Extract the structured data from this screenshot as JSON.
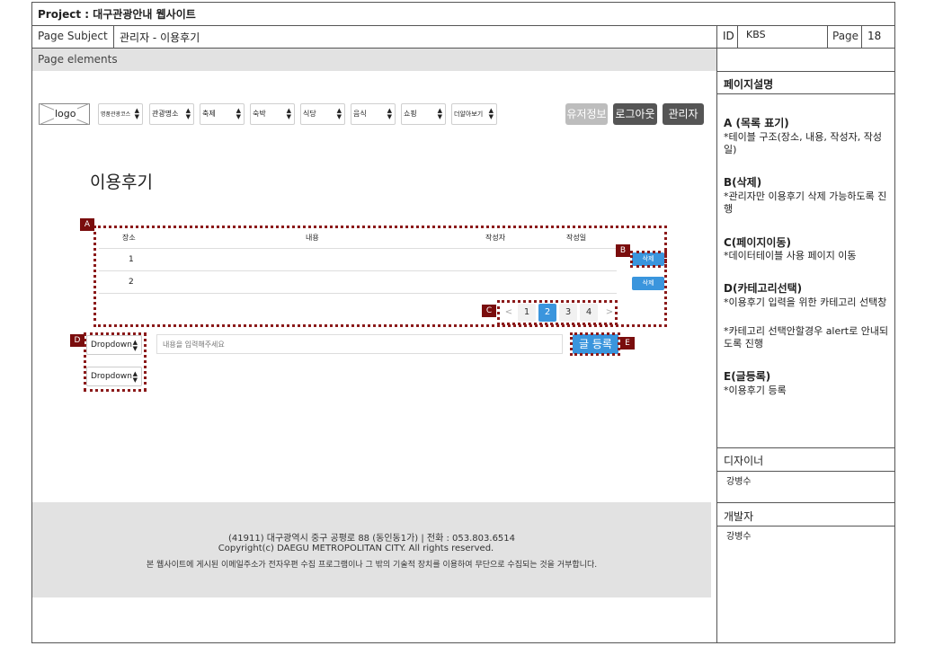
{
  "header": {
    "project": "Project : 대구관광안내 웹사이트",
    "subject_label": "Page Subject",
    "subject_value": "관리자 - 이용후기",
    "id_label": "ID",
    "id_value": "KBS",
    "page_label": "Page",
    "page_value": "18",
    "elements_label": "Page elements"
  },
  "nav": {
    "logo": "logo",
    "menus": [
      "명품관광코스",
      "관광명소",
      "축제",
      "숙박",
      "식당",
      "음식",
      "쇼핑",
      "더알아보기"
    ],
    "user_info": "유저정보",
    "logout": "로그아웃",
    "admin": "관리자"
  },
  "page_title": "이용후기",
  "table": {
    "columns": [
      "장소",
      "내용",
      "작성자",
      "작성일"
    ],
    "rows": [
      {
        "no": "1",
        "delete": "삭제"
      },
      {
        "no": "2",
        "delete": "삭제"
      }
    ]
  },
  "pagination": {
    "prev": "<",
    "pages": [
      "1",
      "2",
      "3",
      "4"
    ],
    "next": ">",
    "active": "2"
  },
  "form": {
    "dropdown1": "Dropdown",
    "dropdown2": "Dropdown",
    "placeholder": "내용을 입력해주세요",
    "submit": "글 등록"
  },
  "tags": {
    "a": "A",
    "b": "B",
    "c": "C",
    "d": "D",
    "e": "E"
  },
  "footer": {
    "line1": "(41911) 대구광역시 중구 공평로 88 (동인동1가) | 전화 : 053.803.6514",
    "line2": "Copyright(c) DAEGU METROPOLITAN CITY. All rights reserved.",
    "line3": "본 웹사이트에 게시된 이메일주소가 전자우편 수집 프로그램이나 그 밖의 기술적 장치를 이용하여 무단으로 수집되는 것을 거부합니다."
  },
  "side": {
    "title": "페이지설명",
    "items": [
      {
        "head": "A (목록 표기)",
        "body": "*테이블 구조(장소, 내용, 작성자, 작성일)"
      },
      {
        "head": "B(삭제)",
        "body": "*관리자만 이용후기 삭제 가능하도록 진행"
      },
      {
        "head": "C(페이지이동)",
        "body": "*데이터테이블 사용 페이지 이동"
      },
      {
        "head": "D(카테고리선택)",
        "body": "*이용후기 입력을 위한 카테고리 선택창"
      },
      {
        "head": "",
        "body": "*카테고리 선택안할경우 alert로 안내되도록 진행"
      },
      {
        "head": "E(글등록)",
        "body": "*이용후기 등록"
      }
    ],
    "designer_label": "디자이너",
    "designer_value": "강병수",
    "developer_label": "개발자",
    "developer_value": "강병수"
  }
}
